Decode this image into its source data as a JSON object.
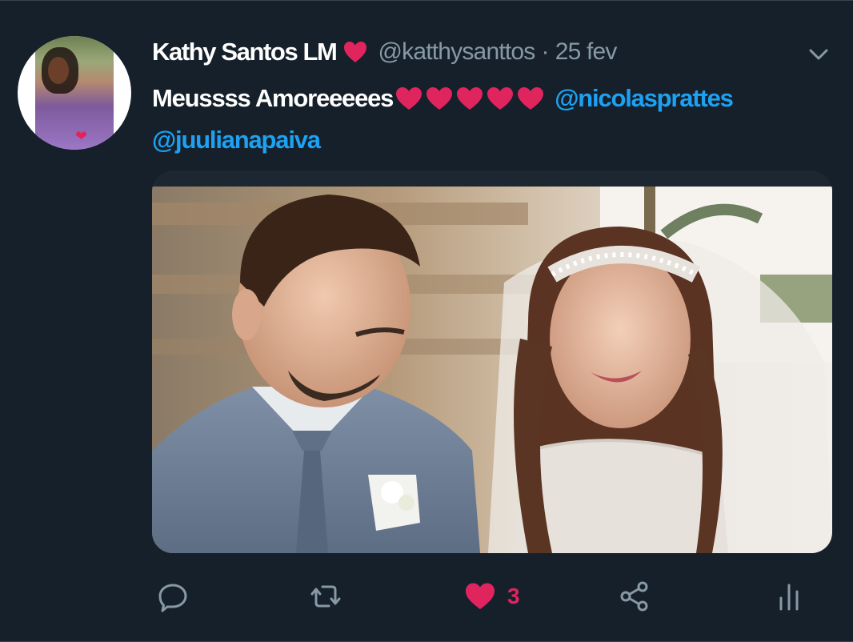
{
  "tweet": {
    "author_name": "Kathy Santos LM",
    "handle": "@katthysanttos",
    "separator": "·",
    "date": "25 fev",
    "text_main": "Meussss Amoreeeees",
    "mention_1": "@nicolasprattes",
    "mention_2": "@juulianapaiva"
  },
  "actions": {
    "like_count": "3"
  },
  "icons": {
    "reply": "reply-icon",
    "retweet": "retweet-icon",
    "like": "heart-icon",
    "share": "share-icon",
    "analytics": "analytics-icon",
    "menu": "chevron-down-icon"
  },
  "colors": {
    "background": "#15202b",
    "mention": "#1da1f2",
    "like": "#e0245e",
    "muted": "#8899a6",
    "emoji_heart": "#e0245e"
  }
}
